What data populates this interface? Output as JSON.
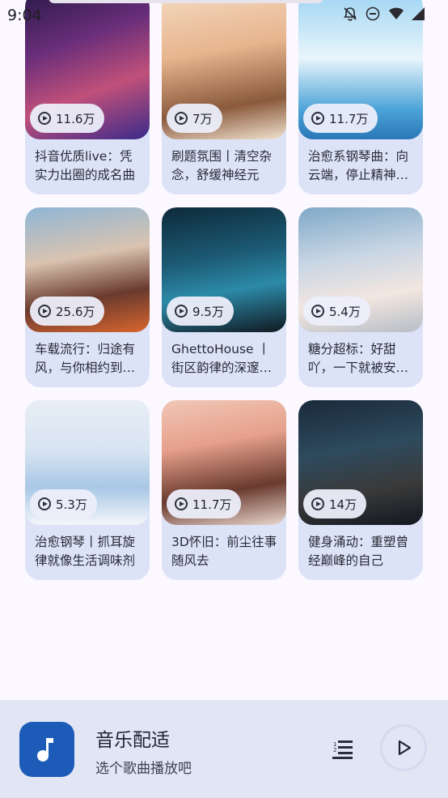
{
  "status_bar": {
    "time": "9:04"
  },
  "cards": [
    {
      "plays": "11.6万",
      "title": "抖音优质live：凭实力出圈的成名曲",
      "art": "art-1"
    },
    {
      "plays": "7万",
      "title": "刷题氛围丨清空杂念，舒缓神经元",
      "art": "art-2"
    },
    {
      "plays": "11.7万",
      "title": "治愈系钢琴曲：向云端，停止精神内耗",
      "art": "art-3"
    },
    {
      "plays": "25.6万",
      "title": "车载流行：归途有风，与你相约到黄昏",
      "art": "art-4"
    },
    {
      "plays": "9.5万",
      "title": "GhettoHouse 丨 街区韵律的深邃律动",
      "art": "art-5"
    },
    {
      "plays": "5.4万",
      "title": "糖分超标：好甜吖，一下就被安利了",
      "art": "art-6"
    },
    {
      "plays": "5.3万",
      "title": "治愈钢琴丨抓耳旋律就像生活调味剂",
      "art": "art-7"
    },
    {
      "plays": "11.7万",
      "title": "3D怀旧：前尘往事随风去",
      "art": "art-8"
    },
    {
      "plays": "14万",
      "title": "健身涌动：重塑曾经巅峰的自己",
      "art": "art-9"
    }
  ],
  "player": {
    "title": "音乐配适",
    "subtitle": "选个歌曲播放吧",
    "playlist_icon": "playlist-icon",
    "play_icon": "play-icon",
    "album_icon": "music-note-icon"
  },
  "colors": {
    "background": "#FBF8FF",
    "card": "#DDE3F7",
    "accent": "#1D5BB8",
    "player_bg": "#E2E6F4"
  }
}
